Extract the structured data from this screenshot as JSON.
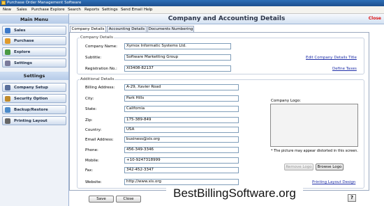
{
  "window": {
    "title": "Purchase Order Management Software"
  },
  "menu": [
    "New",
    "Sales",
    "Purchase",
    "Explore",
    "Search",
    "Reports",
    "Settings",
    "Send Email",
    "Help"
  ],
  "sidebar": {
    "main_heading": "Main Menu",
    "main_items": [
      {
        "label": "Sales",
        "icon": "sales-icon",
        "color": "#3b78c9"
      },
      {
        "label": "Purchase",
        "icon": "purchase-icon",
        "color": "#e09a2b"
      },
      {
        "label": "Explore",
        "icon": "explore-icon",
        "color": "#4a9a44"
      },
      {
        "label": "Settings",
        "icon": "settings-icon",
        "color": "#7a7a9a"
      }
    ],
    "settings_heading": "Settings",
    "settings_items": [
      {
        "label": "Company Setup",
        "icon": "company-icon",
        "color": "#5a6f9a"
      },
      {
        "label": "Security Option",
        "icon": "lock-icon",
        "color": "#c08a2a"
      },
      {
        "label": "Backup/Restore",
        "icon": "backup-icon",
        "color": "#4a8ac9"
      },
      {
        "label": "Printing Layout",
        "icon": "printer-icon",
        "color": "#666666"
      }
    ]
  },
  "header": {
    "title": "Company and Accounting Details",
    "close": "Close"
  },
  "tabs": [
    "Company Details",
    "Accounting Details",
    "Documents Numbering"
  ],
  "company_details": {
    "group_title": "Company Details",
    "company_name": {
      "label": "Company Name:",
      "value": "Xymox Informatic Systems Ltd."
    },
    "subtitle": {
      "label": "Subtitle:",
      "value": "Software Marketting Group"
    },
    "registration": {
      "label": "Registration No.:",
      "value": "XI3408-82137"
    },
    "edit_title_link": "Edit Company Details Title",
    "define_taxes_link": "Define Taxes"
  },
  "additional_details": {
    "group_title": "Additional Details",
    "fields": [
      {
        "label": "Billing Address:",
        "value": "A-29, Xavier Road"
      },
      {
        "label": "City:",
        "value": "Park Hills"
      },
      {
        "label": "State:",
        "value": "California"
      },
      {
        "label": "Zip:",
        "value": "175-389-849"
      },
      {
        "label": "Country:",
        "value": "USA"
      },
      {
        "label": "Email Address:",
        "value": "business@xis.org"
      },
      {
        "label": "Phone:",
        "value": "456-349-3346"
      },
      {
        "label": "Mobile:",
        "value": "+10-9247318999"
      },
      {
        "label": "Fax:",
        "value": "342-452-3347"
      },
      {
        "label": "Website:",
        "value": "http://www.xis.org"
      }
    ]
  },
  "logo": {
    "label": "Company Logo:",
    "note": "* The picture may appear distorted in this screen.",
    "remove": "Remove Logo",
    "browse": "Browse Logo",
    "printing_link": "Printing Layout Design"
  },
  "footer": {
    "save": "Save",
    "close": "Close",
    "help": "?"
  },
  "watermark": "BestBillingSoftware.org"
}
